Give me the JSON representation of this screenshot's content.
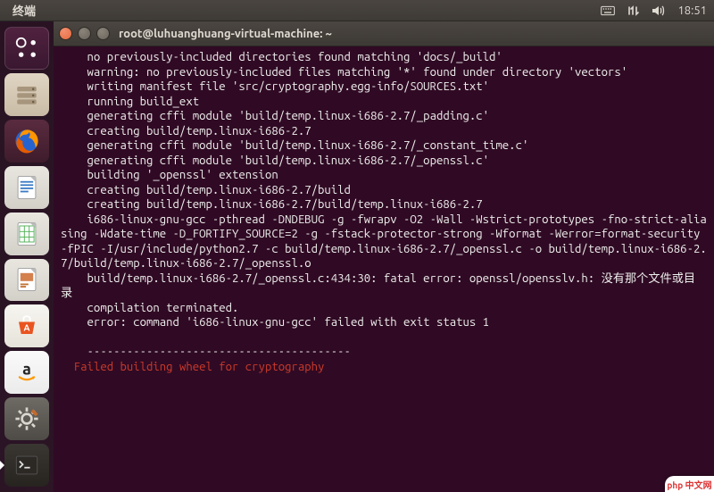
{
  "menubar": {
    "app_label": "终端",
    "clock": "18:51"
  },
  "window": {
    "title": "root@luhuanghuang-virtual-machine: ~"
  },
  "terminal": {
    "lines": [
      "    no previously-included directories found matching 'docs/_build'",
      "    warning: no previously-included files matching '*' found under directory 'vectors'",
      "    writing manifest file 'src/cryptography.egg-info/SOURCES.txt'",
      "    running build_ext",
      "    generating cffi module 'build/temp.linux-i686-2.7/_padding.c'",
      "    creating build/temp.linux-i686-2.7",
      "    generating cffi module 'build/temp.linux-i686-2.7/_constant_time.c'",
      "    generating cffi module 'build/temp.linux-i686-2.7/_openssl.c'",
      "    building '_openssl' extension",
      "    creating build/temp.linux-i686-2.7/build",
      "    creating build/temp.linux-i686-2.7/build/temp.linux-i686-2.7",
      "    i686-linux-gnu-gcc -pthread -DNDEBUG -g -fwrapv -O2 -Wall -Wstrict-prototypes -fno-strict-aliasing -Wdate-time -D_FORTIFY_SOURCE=2 -g -fstack-protector-strong -Wformat -Werror=format-security -fPIC -I/usr/include/python2.7 -c build/temp.linux-i686-2.7/_openssl.c -o build/temp.linux-i686-2.7/build/temp.linux-i686-2.7/_openssl.o",
      "    build/temp.linux-i686-2.7/_openssl.c:434:30: fatal error: openssl/opensslv.h: 没有那个文件或目录",
      "    compilation terminated.",
      "    error: command 'i686-linux-gnu-gcc' failed with exit status 1",
      "    ",
      "    ----------------------------------------"
    ],
    "error_line": "  Failed building wheel for cryptography"
  },
  "badge": {
    "text": "php 中文网"
  }
}
